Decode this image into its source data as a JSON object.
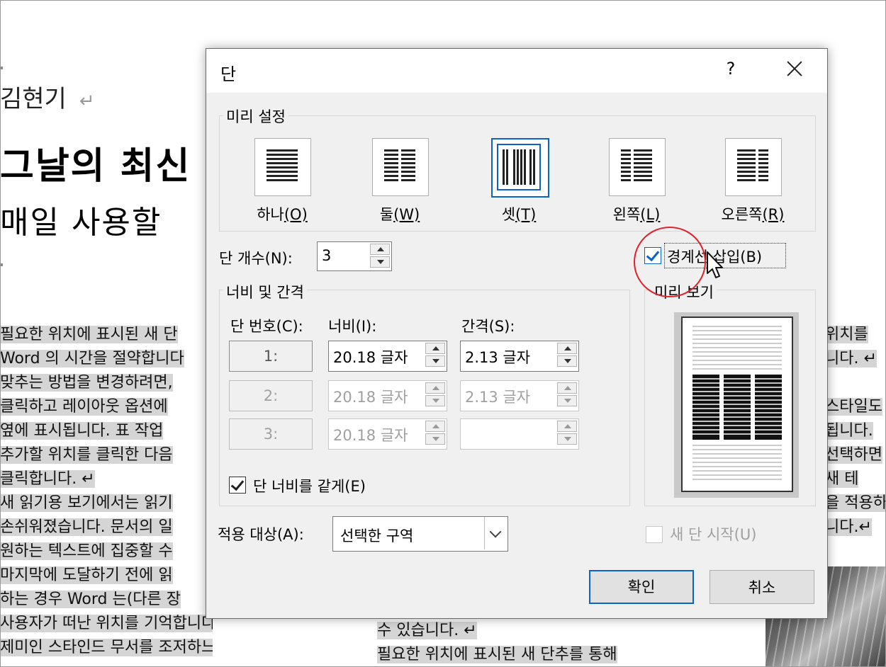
{
  "document": {
    "author": "김현기",
    "paragraph_mark": "↵",
    "title": "그날의 최신",
    "subtitle": "매일 사용할",
    "column1_lines": [
      "필요한 위치에 표시된 새 단",
      "Word 의 시간을 절약합니다",
      "맞추는 방법을 변경하려면,",
      "클릭하고 레이아웃 옵션에",
      "옆에 표시됩니다. 표 작업",
      "추가할 위치를 클릭한 다음",
      "클릭합니다. ↵",
      "새 읽기용 보기에서는 읽기",
      "손쉬워졌습니다. 문서의 일",
      "원하는 텍스트에 집중할 수",
      "마지막에 도달하기 전에 읽",
      "하는 경우 Word 는(다른 장",
      "사용자가 떠난 위치를 기억합니다. ↵",
      "제미인 스타인드 무서를 조저하느 데"
    ],
    "column2_lines": [
      "수 있습니다. ↵",
      "필요한 위치에 표시된 새 단추를 통해"
    ],
    "column3_lines": [
      "위치를",
      "니다. ↵",
      "",
      "스타일도",
      "됩니다.",
      "선택하면",
      "새 테",
      "을 적용하",
      "니다.↵"
    ]
  },
  "dialog": {
    "title": "단",
    "help": "?",
    "presets_group": "미리 설정",
    "presets": [
      {
        "label": "하나",
        "key": "(O)",
        "key_letter": "O",
        "selected": false
      },
      {
        "label": "둘",
        "key": "(W)",
        "key_letter": "W",
        "selected": false
      },
      {
        "label": "셋",
        "key": "(T)",
        "key_letter": "T",
        "selected": true
      },
      {
        "label": "왼쪽",
        "key": "(L)",
        "key_letter": "L",
        "selected": false
      },
      {
        "label": "오른쪽",
        "key": "(R)",
        "key_letter": "R",
        "selected": false
      }
    ],
    "num_columns_label": "단 개수(N):",
    "num_columns_value": "3",
    "line_between_label": "경계선 삽입(B)",
    "line_between_checked": true,
    "width_spacing_group": "너비 및 간격",
    "col_header_num": "단 번호(C):",
    "col_header_width": "너비(I):",
    "col_header_spacing": "간격(S):",
    "rows": [
      {
        "num": "1:",
        "width": "20.18 글자",
        "spacing": "2.13 글자",
        "enabled": true
      },
      {
        "num": "2:",
        "width": "20.18 글자",
        "spacing": "2.13 글자",
        "enabled": false
      },
      {
        "num": "3:",
        "width": "20.18 글자",
        "spacing": "",
        "enabled": false
      }
    ],
    "equal_width_label": "단 너비를 같게(E)",
    "equal_width_checked": true,
    "preview_group": "미리 보기",
    "apply_to_label": "적용 대상(A):",
    "apply_to_value": "선택한 구역",
    "new_column_label": "새 단 시작(U)",
    "new_column_checked": false,
    "ok_label": "확인",
    "cancel_label": "취소"
  },
  "colors": {
    "accent": "#0b63c7",
    "annotation_circle": "#e0202b",
    "highlight": "#d5d5d5"
  }
}
